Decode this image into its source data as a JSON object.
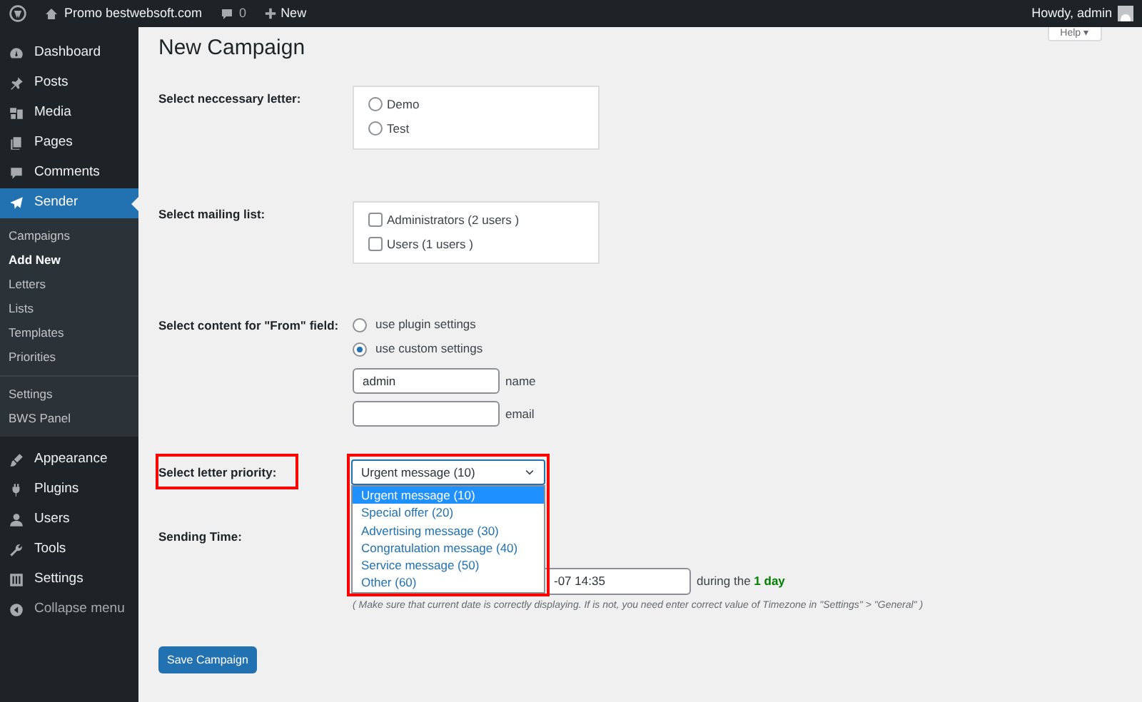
{
  "admin_bar": {
    "site": "Promo bestwebsoft.com",
    "comments": "0",
    "new": "New",
    "greeting": "Howdy, admin"
  },
  "help_tab": "Help ▾",
  "sidebar": {
    "items": [
      {
        "label": "Dashboard",
        "kind": "dashboard",
        "selected": false
      },
      {
        "label": "Posts",
        "kind": "pin",
        "selected": false
      },
      {
        "label": "Media",
        "kind": "media",
        "selected": false
      },
      {
        "label": "Pages",
        "kind": "pages",
        "selected": false
      },
      {
        "label": "Comments",
        "kind": "comment",
        "selected": false
      },
      {
        "label": "Sender",
        "kind": "plane",
        "selected": true,
        "children": [
          {
            "label": "Campaigns",
            "selected": false
          },
          {
            "label": "Add New",
            "selected": true
          },
          {
            "label": "Letters",
            "selected": false
          },
          {
            "label": "Lists",
            "selected": false
          },
          {
            "label": "Templates",
            "selected": false
          },
          {
            "label": "Priorities",
            "selected": false
          },
          {
            "label": "Settings",
            "selected": false,
            "separated": true
          },
          {
            "label": "BWS Panel",
            "selected": false
          }
        ]
      },
      {
        "label": "Appearance",
        "kind": "brush",
        "selected": false
      },
      {
        "label": "Plugins",
        "kind": "plug",
        "selected": false
      },
      {
        "label": "Users",
        "kind": "user",
        "selected": false
      },
      {
        "label": "Tools",
        "kind": "wrench",
        "selected": false
      },
      {
        "label": "Settings",
        "kind": "settings",
        "selected": false
      }
    ],
    "collapse": "Collapse menu"
  },
  "page_title": "New Campaign",
  "letter": {
    "label": "Select neccessary letter:",
    "options": [
      {
        "label": "Demo",
        "selected": false
      },
      {
        "label": "Test",
        "selected": false
      }
    ]
  },
  "mailing_list": {
    "label": "Select mailing list:",
    "options": [
      {
        "label": "Administrators (2 users )",
        "checked": false
      },
      {
        "label": "Users (1 users )",
        "checked": false
      }
    ]
  },
  "from": {
    "label": "Select content for \"From\" field:",
    "options": [
      {
        "label": "use plugin settings",
        "selected": false
      },
      {
        "label": "use custom settings",
        "selected": true
      }
    ],
    "fields": [
      {
        "value": "admin",
        "caption": "name"
      },
      {
        "caption": "email"
      }
    ]
  },
  "priority": {
    "label": "Select letter priority:",
    "value": "Urgent message (10)",
    "options": [
      {
        "label": "Urgent message (10)",
        "selected": true
      },
      {
        "label": "Special offer (20)",
        "selected": false
      },
      {
        "label": "Advertising message (30)",
        "selected": false
      },
      {
        "label": "Congratulation message (40)",
        "selected": false
      },
      {
        "label": "Service message (50)",
        "selected": false
      },
      {
        "label": "Other (60)",
        "selected": false
      }
    ]
  },
  "sending_time": {
    "label": "Sending Time:",
    "time_value": "-07 14:35",
    "during": "during the **1 day**",
    "note": "( Make sure that current date is correctly displaying. If is not, you need enter correct value of Timezone in \"Settings\" > \"General\" )"
  },
  "save_button": "Save Campaign"
}
